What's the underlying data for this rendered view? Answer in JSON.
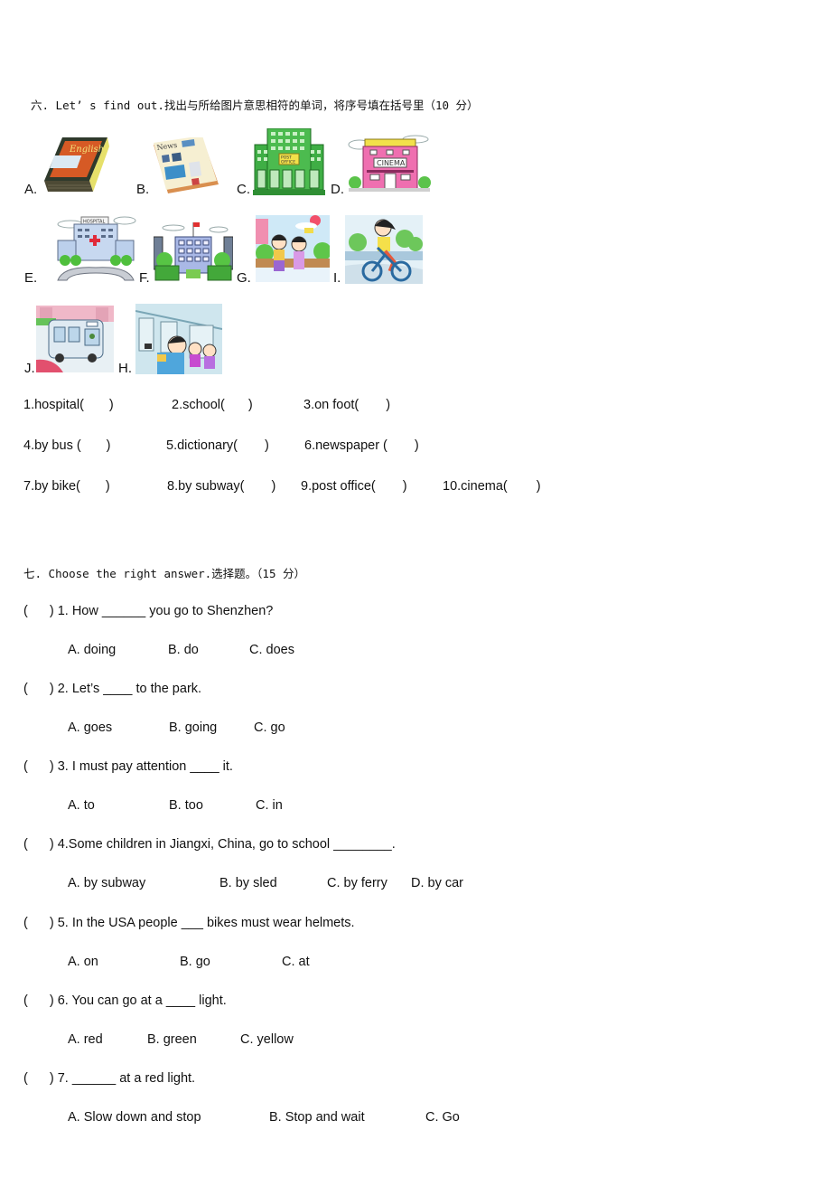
{
  "section6": {
    "title": "六. Let’ s find out.找出与所给图片意思相符的单词，将序号填在括号里（10 分）",
    "pictures": [
      {
        "label": "A.",
        "icon": "dictionary-book-icon",
        "caption_on_image": "English"
      },
      {
        "label": "B.",
        "icon": "newspaper-icon",
        "caption_on_image": "News"
      },
      {
        "label": "C.",
        "icon": "post-office-building-icon",
        "caption_on_image": "POST OFFICE"
      },
      {
        "label": "D.",
        "icon": "cinema-building-icon",
        "caption_on_image": "CINEMA"
      },
      {
        "label": "E.",
        "icon": "hospital-building-icon",
        "caption_on_image": "HOSPITAL"
      },
      {
        "label": "F.",
        "icon": "school-building-icon"
      },
      {
        "label": "G.",
        "icon": "children-walking-icon"
      },
      {
        "label": "I.",
        "icon": "girl-riding-bike-icon"
      },
      {
        "label": "J.",
        "icon": "bus-icon"
      },
      {
        "label": "H.",
        "icon": "subway-train-icon"
      }
    ],
    "items": [
      [
        "1.hospital(",
        ")"
      ],
      [
        "2.school(",
        ")"
      ],
      [
        "3.on foot(",
        ")"
      ],
      [
        "4.by bus (",
        ")"
      ],
      [
        "5.dictionary(",
        ")"
      ],
      [
        "6.newspaper (",
        ")"
      ],
      [
        "7.by bike(",
        ")"
      ],
      [
        "8.by subway(",
        ")"
      ],
      [
        "9.post office(",
        ")"
      ],
      [
        "10.cinema(",
        ")"
      ]
    ]
  },
  "section7": {
    "title": "七. Choose the right answer.选择题。（15 分）",
    "questions": [
      {
        "open": "(",
        "text": ") 1. How ______ you go to Shenzhen?",
        "options": [
          "A. doing",
          "B. do",
          "C. does"
        ]
      },
      {
        "open": "(",
        "text": ") 2. Let’s ____ to the park.",
        "options": [
          "A. goes",
          "B. going",
          "C. go"
        ]
      },
      {
        "open": "(",
        "text": ") 3. I must pay attention ____ it.",
        "options": [
          "A. to",
          "B. too",
          "C. in"
        ]
      },
      {
        "open": "(",
        "text": ") 4.Some children in Jiangxi, China, go to school ________.",
        "options": [
          "A. by subway",
          "B. by sled",
          "C. by ferry",
          "D. by car"
        ]
      },
      {
        "open": "(",
        "text": ") 5. In the USA people ___ bikes must wear helmets.",
        "options": [
          "A. on",
          "B. go",
          "C. at"
        ]
      },
      {
        "open": "(",
        "text": ") 6. You can go at a ____ light.",
        "options": [
          "A. red",
          "B. green",
          "C. yellow"
        ]
      },
      {
        "open": "(",
        "text": ") 7. ______ at a red light.",
        "options": [
          "A. Slow down and stop",
          "B. Stop and wait",
          "C. Go"
        ]
      }
    ]
  }
}
